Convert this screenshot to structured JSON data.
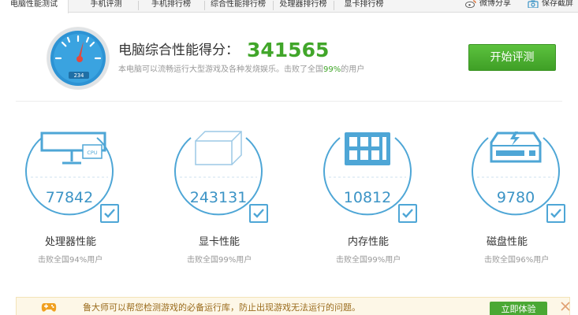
{
  "tabs": [
    {
      "label": "电脑性能测试",
      "active": true
    },
    {
      "label": "手机评测",
      "active": false
    },
    {
      "label": "手机排行榜",
      "active": false
    },
    {
      "label": "综合性能排行榜",
      "active": false
    },
    {
      "label": "处理器排行榜",
      "active": false
    },
    {
      "label": "显卡排行榜",
      "active": false
    }
  ],
  "top_actions": {
    "weibo_share": "微博分享",
    "save_screenshot": "保存截屏"
  },
  "score": {
    "label": "电脑综合性能得分：",
    "value": "341565",
    "desc_before": "本电脑可以流畅运行大型游戏及各种发烧娱乐。击败了全国",
    "desc_pct": "99%",
    "desc_after": "的用户",
    "gauge_readout": "234",
    "start_button": "开始评测"
  },
  "categories": [
    {
      "icon": "monitor-cpu-icon",
      "value": "77842",
      "name": "处理器性能",
      "sub": "击败全国94%用户",
      "icon_text": "CPU"
    },
    {
      "icon": "graphics-cube-icon",
      "value": "243131",
      "name": "显卡性能",
      "sub": "击败全国99%用户"
    },
    {
      "icon": "memory-chip-icon",
      "value": "10812",
      "name": "内存性能",
      "sub": "击败全国99%用户"
    },
    {
      "icon": "hard-disk-icon",
      "value": "9780",
      "name": "磁盘性能",
      "sub": "击败全国96%用户"
    }
  ],
  "notice": {
    "text": "鲁大师可以帮您检测游戏的必备运行库，防止出现游戏无法运行的问题。",
    "button": "立即体验"
  },
  "colors": {
    "accent_green": "#41a62a",
    "accent_blue": "#4ea6d6",
    "circle_value_blue": "#3c94c6"
  }
}
